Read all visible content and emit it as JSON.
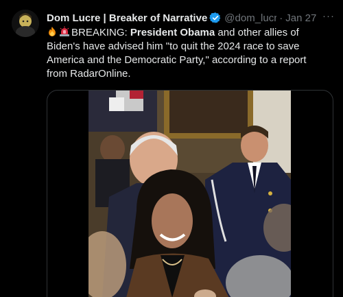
{
  "author": {
    "display_name": "Dom Lucre | Breaker of Narrative",
    "handle": "@dom_lucre",
    "separator": "·",
    "date": "Jan 27",
    "more_label": "···"
  },
  "tweet": {
    "emoji_1": "fire-emoji",
    "emoji_2": "siren-emoji",
    "lead": "BREAKING: ",
    "bold": "President Obama",
    "rest": " and other allies of Biden's have advised him \"to quit the 2024 race to save America and the Democratic Party,\" according to a report from RadarOnline."
  },
  "colors": {
    "background": "#000000",
    "text": "#e7e9ea",
    "muted": "#71767b",
    "verified": "#1d9bf0",
    "border": "#2f3336"
  },
  "media": {
    "type": "video"
  }
}
